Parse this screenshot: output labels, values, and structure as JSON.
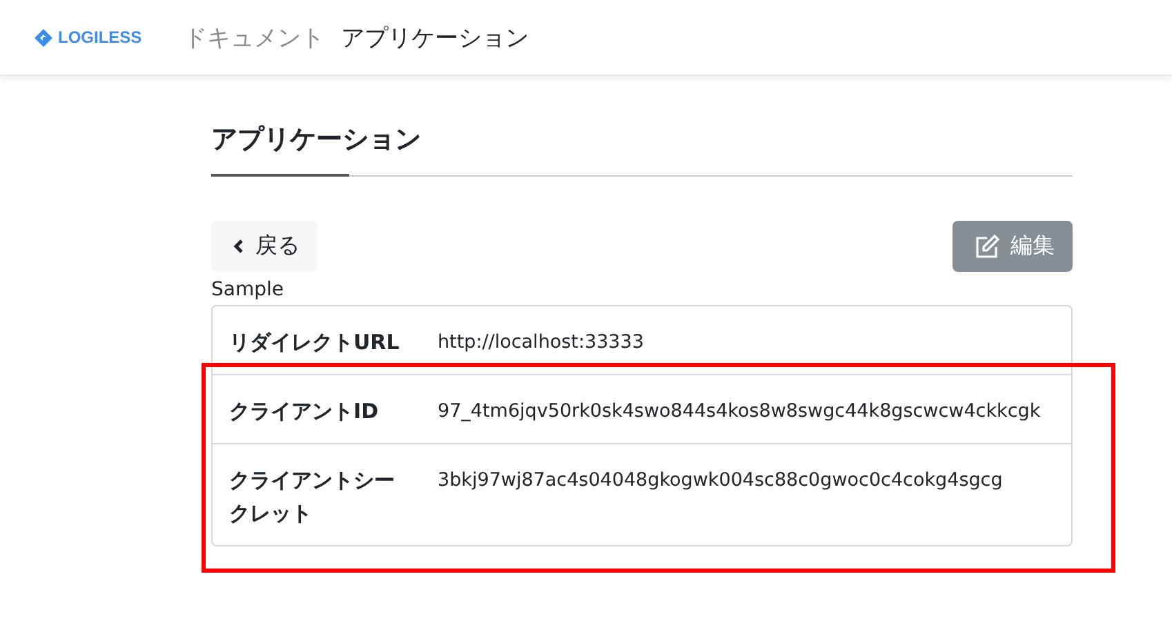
{
  "header": {
    "logo": "LOGILESS",
    "nav": [
      {
        "label": "ドキュメント",
        "selected": false
      },
      {
        "label": "アプリケーション",
        "selected": true
      }
    ]
  },
  "page": {
    "title": "アプリケーション",
    "back_button": "戻る",
    "edit_button": "編集",
    "name": "Sample",
    "rows": [
      {
        "label": "リダイレクトURL",
        "value": "http://localhost:33333",
        "highlighted": false
      },
      {
        "label": "クライアントID",
        "value": "97_4tm6jqv50rk0sk4swo844s4kos8w8swgc44k8gscwcw4ckkcgk",
        "highlighted": true
      },
      {
        "label": "クライアントシークレット",
        "value": "3bkj97wj87ac4s04048gkogwk004sc88c0gwoc0c4cokg4sgcg",
        "highlighted": true
      }
    ]
  }
}
